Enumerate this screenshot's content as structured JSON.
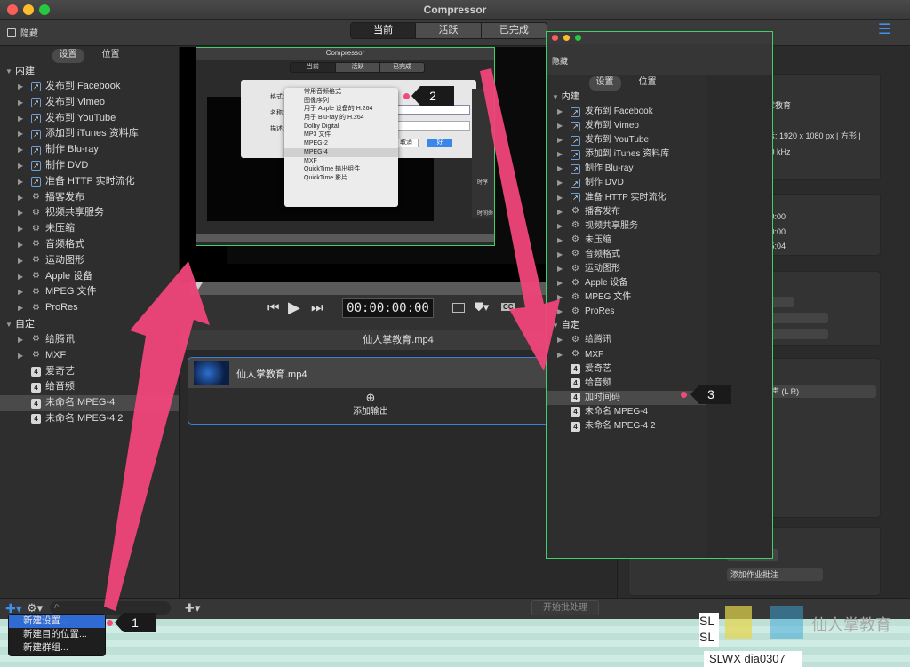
{
  "window": {
    "title": "Compressor"
  },
  "toolbar": {
    "hide_label": "隐藏",
    "tabs": [
      "当前",
      "活跃",
      "已完成"
    ],
    "active_tab": "当前"
  },
  "left_panel": {
    "tabs": [
      "设置",
      "位置"
    ],
    "builtin_header": "内建",
    "builtin_items": [
      {
        "label": "发布到 Facebook",
        "icon": "publish-icon"
      },
      {
        "label": "发布到 Vimeo",
        "icon": "publish-icon"
      },
      {
        "label": "发布到 YouTube",
        "icon": "publish-icon"
      },
      {
        "label": "添加到 iTunes 资料库",
        "icon": "publish-icon"
      },
      {
        "label": "制作 Blu-ray",
        "icon": "publish-icon"
      },
      {
        "label": "制作 DVD",
        "icon": "publish-icon"
      },
      {
        "label": "准备 HTTP 实时流化",
        "icon": "publish-icon"
      },
      {
        "label": "播客发布",
        "icon": "settings-group-icon"
      },
      {
        "label": "视频共享服务",
        "icon": "settings-group-icon"
      },
      {
        "label": "未压缩",
        "icon": "settings-group-icon"
      },
      {
        "label": "音频格式",
        "icon": "settings-group-icon"
      },
      {
        "label": "运动图形",
        "icon": "settings-group-icon"
      },
      {
        "label": "Apple 设备",
        "icon": "settings-group-icon"
      },
      {
        "label": "MPEG 文件",
        "icon": "settings-group-icon"
      },
      {
        "label": "ProRes",
        "icon": "settings-group-icon"
      }
    ],
    "custom_header": "自定",
    "custom_items": [
      {
        "label": "给腾讯",
        "icon": "settings-group-icon",
        "expandable": true
      },
      {
        "label": "MXF",
        "icon": "settings-group-icon",
        "expandable": true
      },
      {
        "label": "爱奇艺",
        "icon": "mpeg4-icon",
        "expandable": false
      },
      {
        "label": "给音频",
        "icon": "mpeg4-icon",
        "expandable": false
      },
      {
        "label": "未命名 MPEG-4",
        "icon": "mpeg4-icon",
        "expandable": false,
        "selected": true
      },
      {
        "label": "未命名 MPEG-4 2",
        "icon": "mpeg4-icon",
        "expandable": false
      }
    ]
  },
  "preview": {
    "timecode": "00:00:00:00"
  },
  "batch": {
    "title": "仙人掌教育.mp4",
    "job_name": "仙人掌教育.mp4",
    "add_output": "添加输出",
    "start_button": "开始批处理"
  },
  "inspector": {
    "title_fragment": "作业",
    "name_fragment": "人掌教育",
    "display_fragment": "显示: 1920 x 1080 px | 方形 |",
    "audio_fragment": "4.10 kHz",
    "time1": "0:00:00",
    "time2": "0:00:00",
    "time3": "0:05:04",
    "channel_fragment": "立体声 (L R)",
    "add_annotation": "添加作业批注"
  },
  "add_menu": {
    "items": [
      "新建设置...",
      "新建目的位置...",
      "新建群组..."
    ],
    "highlighted": 0
  },
  "format_dialog": {
    "title": "Compressor",
    "tabs": [
      "当前",
      "活跃",
      "已完成"
    ],
    "labels": [
      "格式:",
      "名称:",
      "描述:"
    ],
    "cancel": "取消",
    "ok": "好",
    "menu_items": [
      "常用音频格式",
      "图像序列",
      "用于 Apple 设备的 H.264",
      "用于 Blu-ray 的 H.264",
      "Dolby Digital",
      "MP3 文件",
      "MPEG-2",
      "MPEG-4",
      "MXF",
      "QuickTime 输出组件",
      "QuickTime 影片"
    ],
    "highlighted": "MPEG-4",
    "side_labels": [
      "时序",
      "时间命",
      "文件"
    ]
  },
  "inset_sidebar": {
    "hide_label": "隐藏",
    "tabs": [
      "设置",
      "位置"
    ],
    "builtin_header": "内建",
    "builtin_items": [
      "发布到 Facebook",
      "发布到 Vimeo",
      "发布到 YouTube",
      "添加到 iTunes 资料库",
      "制作 Blu-ray",
      "制作 DVD",
      "准备 HTTP 实时流化",
      "播客发布",
      "视频共享服务",
      "未压缩",
      "音频格式",
      "运动图形",
      "Apple 设备",
      "MPEG 文件",
      "ProRes"
    ],
    "custom_header": "自定",
    "custom_items": [
      "给腾讯",
      "MXF",
      "爱奇艺",
      "给音频",
      "加时间码",
      "未命名 MPEG-4",
      "未命名 MPEG-4 2"
    ],
    "selected": "加时间码"
  },
  "callouts": [
    "1",
    "2",
    "3"
  ],
  "watermark": {
    "brand": "仙人掌教育",
    "code": "SLWX dia0307",
    "side_code": "SL SL"
  },
  "colors": {
    "accent": "#3d7fd5",
    "arrow": "#f0447a",
    "inset_border": "#3fd069",
    "menu_highlight": "#2f6bd3"
  }
}
